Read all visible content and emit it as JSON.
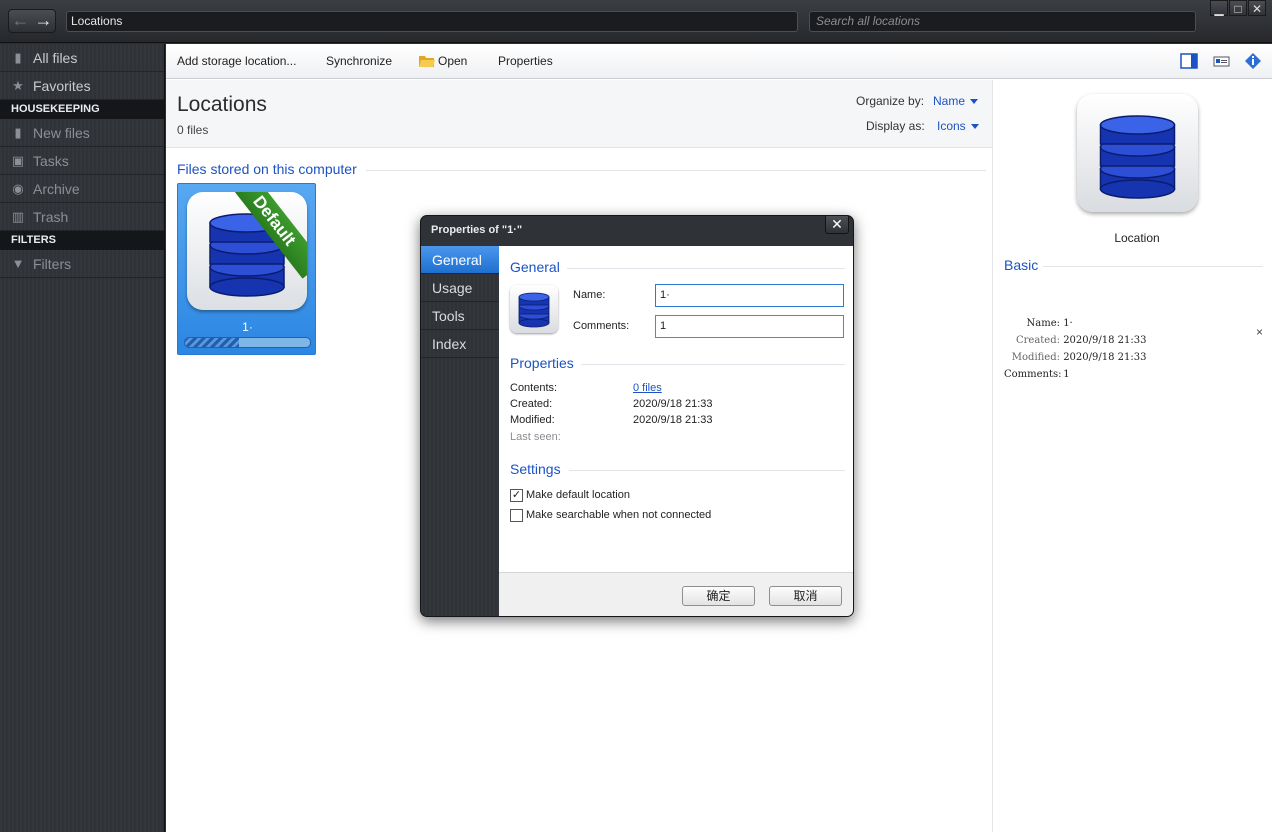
{
  "titlebar": {
    "path": "Locations",
    "search_placeholder": "Search all locations",
    "window_controls": [
      "minimize-icon",
      "maximize-icon",
      "close-icon"
    ]
  },
  "sidebar": {
    "items_top": [
      {
        "label": "All files",
        "icon": "file-icon"
      },
      {
        "label": "Favorites",
        "icon": "star-icon"
      }
    ],
    "header_housekeeping": "HOUSEKEEPING",
    "items_housekeeping": [
      {
        "label": "New files",
        "icon": "new-file-icon"
      },
      {
        "label": "Tasks",
        "icon": "tasks-icon"
      },
      {
        "label": "Archive",
        "icon": "archive-icon"
      },
      {
        "label": "Trash",
        "icon": "trash-icon"
      }
    ],
    "header_filters": "FILTERS",
    "items_filters": [
      {
        "label": "Filters",
        "icon": "filter-icon"
      }
    ]
  },
  "toolbar": {
    "add_storage": "Add storage location...",
    "synchronize": "Synchronize",
    "open": "Open",
    "properties": "Properties"
  },
  "content": {
    "title": "Locations",
    "file_count": "0 files",
    "organize_label": "Organize by:",
    "organize_value": "Name",
    "display_label": "Display as:",
    "display_value": "Icons",
    "section": "Files stored on this computer",
    "tile": {
      "label": "1·",
      "ribbon": "Default",
      "usage_fraction": 0.43
    }
  },
  "right_panel": {
    "caption": "Location",
    "basic_title": "Basic",
    "rows": [
      {
        "key": "Name:",
        "value": "1·"
      },
      {
        "key": "Created:",
        "value": "2020/9/18 21:33"
      },
      {
        "key": "Modified:",
        "value": "2020/9/18 21:33"
      },
      {
        "key": "Comments:",
        "value": "1"
      }
    ],
    "clear": "×"
  },
  "dialog": {
    "title": "Properties of \"1·\"",
    "close": "✕",
    "tabs": [
      "General",
      "Usage",
      "Tools",
      "Index"
    ],
    "general_title": "General",
    "name_label": "Name:",
    "name_value": "1·",
    "comments_label": "Comments:",
    "comments_value": "1",
    "properties_title": "Properties",
    "contents_label": "Contents:",
    "contents_value": "0 files",
    "created_label": "Created:",
    "created_value": "2020/9/18 21:33",
    "modified_label": "Modified:",
    "modified_value": "2020/9/18 21:33",
    "last_seen_label": "Last seen:",
    "settings_title": "Settings",
    "default_label": "Make default location",
    "default_checked": true,
    "searchable_label": "Make searchable when not connected",
    "searchable_checked": false,
    "ok": "确定",
    "cancel": "取消"
  },
  "colors": {
    "accent": "#1b53c4",
    "selection": "#2b86e2",
    "ribbon": "#2a7d1e",
    "sidebar": "#2f3237"
  }
}
